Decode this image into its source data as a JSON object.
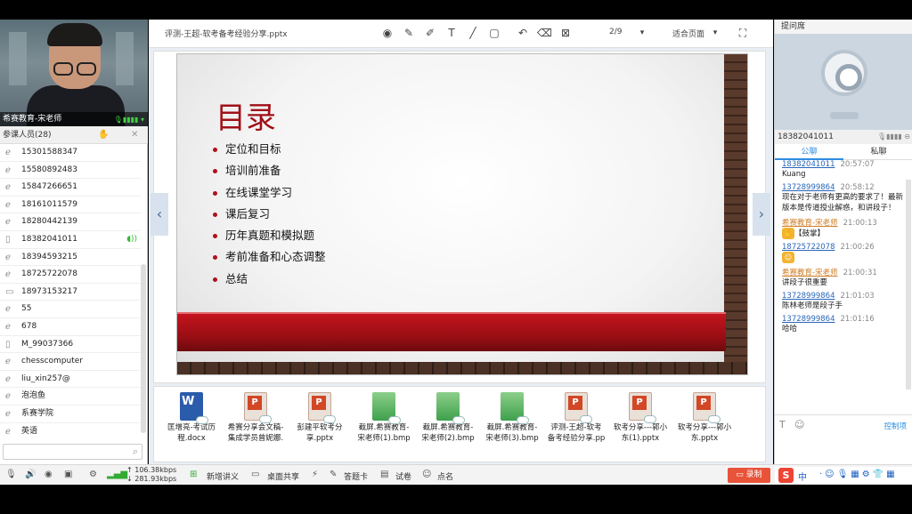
{
  "presenter": {
    "name": "希赛教育-宋老师"
  },
  "members": {
    "header": "参课人员(28)",
    "items": [
      {
        "name": "15301588347",
        "icon": "ie-icon"
      },
      {
        "name": "15580892483",
        "icon": "ie-icon"
      },
      {
        "name": "15847266651",
        "icon": "ie-icon"
      },
      {
        "name": "18161011579",
        "icon": "ie-icon"
      },
      {
        "name": "18280442139",
        "icon": "ie-icon"
      },
      {
        "name": "18382041011",
        "icon": "phone-icon"
      },
      {
        "name": "18394593215",
        "icon": "ie-icon"
      },
      {
        "name": "18725722078",
        "icon": "ie-icon"
      },
      {
        "name": "18973153217",
        "icon": "monitor-icon"
      },
      {
        "name": "55",
        "icon": "ie-icon"
      },
      {
        "name": "678",
        "icon": "ie-icon"
      },
      {
        "name": "M_99037366",
        "icon": "phone-icon"
      },
      {
        "name": "chesscomputer",
        "icon": "ie-icon"
      },
      {
        "name": "liu_xin257@",
        "icon": "ie-icon"
      },
      {
        "name": "泡泡鱼",
        "icon": "ie-icon"
      },
      {
        "name": "系赛学院",
        "icon": "ie-icon"
      },
      {
        "name": "英语",
        "icon": "ie-icon"
      }
    ]
  },
  "toolbar": {
    "filename": "评测-王超-软考备考经验分享.pptx",
    "page": "2/9",
    "fit": "适合页面"
  },
  "slide": {
    "title": "目录",
    "bullets": [
      "定位和目标",
      "培训前准备",
      "在线课堂学习",
      "课后复习",
      "历年真题和模拟题",
      "考前准备和心态调整",
      "总结"
    ]
  },
  "files": [
    {
      "label": "匡增亮-考试历\n程.docx",
      "type": "doc"
    },
    {
      "label": "希赛分享会文稿-\n集成学员曾妮娜.",
      "type": "ppt"
    },
    {
      "label": "彭建平软考分\n享.pptx",
      "type": "ppt"
    },
    {
      "label": "截屏.希赛教育-\n宋老师(1).bmp",
      "type": "bmp"
    },
    {
      "label": "截屏.希赛教育-\n宋老师(2).bmp",
      "type": "bmp"
    },
    {
      "label": "截屏.希赛教育-\n宋老师(3).bmp",
      "type": "bmp"
    },
    {
      "label": "评测-王超-软考\n备考经验分享.pp",
      "type": "ppt"
    },
    {
      "label": "软考分享---郭小\n东(1).pptx",
      "type": "ppt"
    },
    {
      "label": "软考分享---郭小\n东.pptx",
      "type": "ppt"
    }
  ],
  "right": {
    "header": "提问席",
    "student": "18382041011",
    "tabs": [
      "公聊",
      "私聊"
    ],
    "messages": [
      {
        "who": "18382041011",
        "time": "20:57:07",
        "text": "Kuang",
        "teacher": false
      },
      {
        "who": "13728999864",
        "time": "20:58:12",
        "text": "现在对于老师有更高的要求了！最新版本是传道授业解惑，和讲段子！",
        "teacher": false
      },
      {
        "who": "希赛教育-宋老师",
        "time": "21:00:13",
        "text": "【鼓掌】",
        "teacher": true
      },
      {
        "who": "18725722078",
        "time": "21:00:26",
        "text": "",
        "teacher": false
      },
      {
        "who": "希赛教育-宋老师",
        "time": "21:00:31",
        "text": "讲段子很重要",
        "teacher": true
      },
      {
        "who": "13728999864",
        "time": "21:01:03",
        "text": "陈林老师是段子手",
        "teacher": false
      },
      {
        "who": "13728999864",
        "time": "21:01:16",
        "text": "哈哈",
        "teacher": false
      }
    ],
    "control": "控制项"
  },
  "bottombar": {
    "up": "106.38kbps",
    "down": "281.93kbps",
    "new_lecture": "新增讲义",
    "desktop_share": "桌面共享",
    "answer_card": "答题卡",
    "quiz": "试卷",
    "roll_call": "点名",
    "record": "录制"
  },
  "ime": {
    "logo": "S",
    "mode": "中"
  }
}
